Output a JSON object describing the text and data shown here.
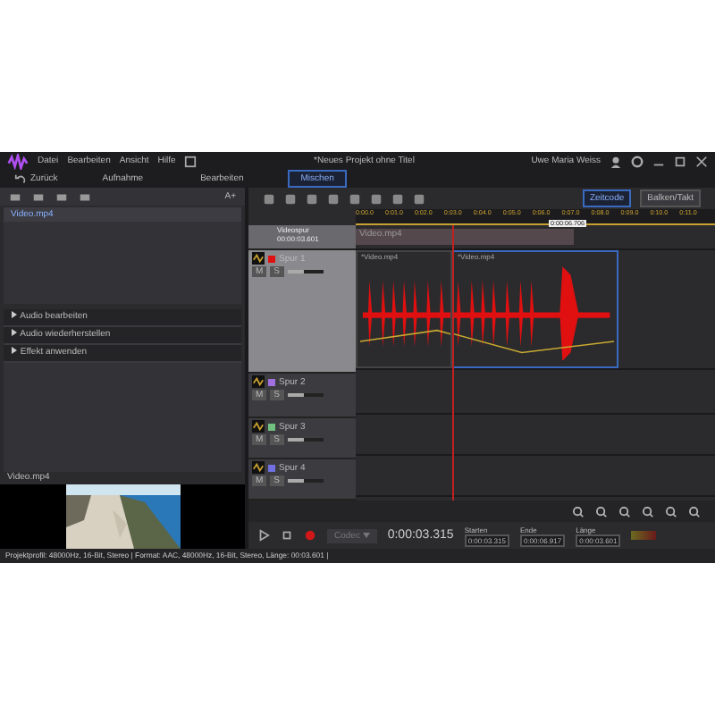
{
  "menu": [
    "Datei",
    "Bearbeiten",
    "Ansicht",
    "Hilfe"
  ],
  "title": "*Neues Projekt ohne Titel",
  "user": "Uwe Maria Weiss",
  "nav": {
    "back": "Zurück",
    "tabs": [
      {
        "label": "Aufnahme",
        "selected": false
      },
      {
        "label": "Bearbeiten",
        "selected": false
      },
      {
        "label": "Mischen",
        "selected": true
      }
    ]
  },
  "library": {
    "font_button": "A+",
    "files": [
      {
        "name": "Video.mp4",
        "selected": true
      }
    ]
  },
  "sections": [
    {
      "label": "Audio bearbeiten",
      "expanded": false
    },
    {
      "label": "Audio wiederherstellen",
      "expanded": false
    },
    {
      "label": "Effekt anwenden",
      "expanded": false
    }
  ],
  "preview": {
    "title": "Video.mp4",
    "kind": "picture"
  },
  "status_bar": "Projektprofil: 48000Hz, 16-Bit, Stereo | Format: AAC, 48000Hz, 16-Bit, Stereo, Länge: 00:03.601 |",
  "timeline_modes": [
    {
      "label": "Zeitcode",
      "selected": true
    },
    {
      "label": "Balken/Takt",
      "selected": false
    }
  ],
  "ruler": [
    "0:00.0",
    "0:01.0",
    "0:02.0",
    "0:03.0",
    "0:04.0",
    "0:05.0",
    "0:06.0",
    "0:07.0",
    "0:08.0",
    "0:09.0",
    "0:10.0",
    "0:11.0"
  ],
  "cursor_tooltip": "0:00:06.706",
  "video_track": {
    "name": "Videospur",
    "duration": "00:00:03.601",
    "clip": "Video.mp4"
  },
  "tracks": [
    {
      "name": "Spur 1",
      "color": "#e01010",
      "level": 0.45,
      "mute_label": "M",
      "muted": false,
      "solo_label": "S",
      "solo": false,
      "clips": [
        "*Video.mp4",
        "*Video.mp4"
      ]
    },
    {
      "name": "Spur 2",
      "color": "#a070e0",
      "level": 0.45,
      "mute_label": "M",
      "muted": false,
      "solo_label": "S",
      "solo": false
    },
    {
      "name": "Spur 3",
      "color": "#70c080",
      "level": 0.45,
      "mute_label": "M",
      "muted": false,
      "solo_label": "S",
      "solo": false
    },
    {
      "name": "Spur 4",
      "color": "#7070e0",
      "level": 0.45,
      "mute_label": "M",
      "muted": false,
      "solo_label": "S",
      "solo": false
    }
  ],
  "transport": {
    "time_format": "Codec",
    "timecode": "0:00:03.315",
    "start_label": "Starten",
    "start": "0:00:03.315",
    "end_label": "Ende",
    "end": "0:00:06.917",
    "length_label": "Länge",
    "length": "0:00:03.601"
  }
}
